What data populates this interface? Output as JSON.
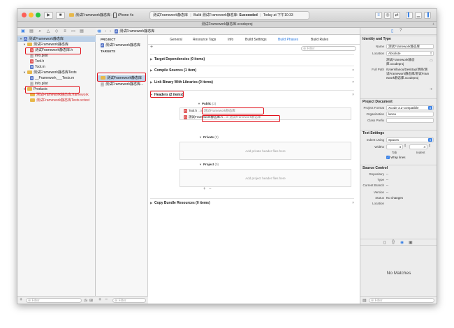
{
  "toolbar": {
    "scheme": "测试Framework静态库",
    "device": "iPhone 4s",
    "activity": {
      "project": "测试Framework静态库",
      "build": "Build 测试Framework静态库: ",
      "status": "Succeeded",
      "time": "Today at 下午10:33"
    }
  },
  "path_title": "测试Framework静态库.xcodeproj",
  "navigator": {
    "items": [
      {
        "label": "测试Framework静态库",
        "kind": "project",
        "indent": 0
      },
      {
        "label": "测试Framework静态库",
        "kind": "folder",
        "indent": 1
      },
      {
        "label": "测试Framework静态库.h",
        "kind": "h",
        "indent": 2
      },
      {
        "label": "Info.plist",
        "kind": "plist",
        "indent": 2
      },
      {
        "label": "Tool.h",
        "kind": "h",
        "indent": 2
      },
      {
        "label": "Tool.m",
        "kind": "m",
        "indent": 2
      },
      {
        "label": "测试Framework静态库Tests",
        "kind": "folder",
        "indent": 1
      },
      {
        "label": "__Framework___Tests.m",
        "kind": "m",
        "indent": 2
      },
      {
        "label": "Info.plist",
        "kind": "plist",
        "indent": 2
      },
      {
        "label": "Products",
        "kind": "folder",
        "indent": 1
      },
      {
        "label": "测试Framework静态库.framework",
        "kind": "product",
        "indent": 2
      },
      {
        "label": "测试Framework静态库Tests.xctest",
        "kind": "product",
        "indent": 2
      }
    ],
    "filter_placeholder": "Filter"
  },
  "jump_bar": {
    "crumb": "测试Framework静态库"
  },
  "targets_panel": {
    "project_header": "PROJECT",
    "project_item": "测试Framework静态库",
    "targets_header": "TARGETS",
    "target_items": [
      "测试Framework静态库",
      "测试Framework静态库..."
    ],
    "filter_placeholder": "Filter"
  },
  "editor": {
    "tabs": [
      "General",
      "Resource Tags",
      "Info",
      "Build Settings",
      "Build Phases",
      "Build Rules"
    ],
    "active_tab": "Build Phases",
    "filter_placeholder": "Filter",
    "phases": {
      "target_deps": "Target Dependencies (0 items)",
      "compile": "Compile Sources (1 item)",
      "link": "Link Binary With Libraries (0 items)",
      "headers": "Headers (2 items)",
      "copy": "Copy Bundle Resources (0 items)"
    },
    "headers": {
      "public_label": "Public",
      "public_count": "(2)",
      "public_files": [
        {
          "name": "Tool.h",
          "path": "...in 测试Framework静态库"
        },
        {
          "name": "测试Framework静态库.h",
          "path": "...in 测试Framework静态库"
        }
      ],
      "private_label": "Private",
      "private_count": "(0)",
      "private_placeholder": "Add private header files here",
      "project_label": "Project",
      "project_count": "(0)",
      "project_placeholder": "Add project header files here"
    }
  },
  "inspector": {
    "identity_title": "Identity and Type",
    "name_label": "Name",
    "name_value": "测试Framework静态库",
    "location_label": "Location",
    "location_value": "Absolute",
    "location_file": "测试Framework静态库.xcodeproj",
    "fullpath_label": "Full Path",
    "fullpath_value": "/Users/lanou/Desktop/项目/测试Framework静态库/测试Framework静态库.xcodeproj",
    "project_doc_title": "Project Document",
    "format_label": "Project Format",
    "format_value": "Xcode 3.2-compatible",
    "org_label": "Organization",
    "org_value": "lanou",
    "class_prefix_label": "Class Prefix",
    "text_settings_title": "Text Settings",
    "indent_using_label": "Indent Using",
    "indent_using_value": "Spaces",
    "widths_label": "Widths",
    "tab_value": "4",
    "indent_value": "4",
    "tab_label": "Tab",
    "indent_label": "Indent",
    "wrap_lines": "Wrap lines",
    "source_control_title": "Source Control",
    "repository_label": "Repository",
    "type_label": "Type",
    "branch_label": "Current Branch",
    "version_label": "Version",
    "status_label": "Status",
    "status_value": "No changes",
    "sc_location_label": "Location",
    "dash": "--",
    "no_matches": "No Matches",
    "filter_placeholder": "Filter"
  },
  "colors": {
    "accent": "#2a7ae2",
    "highlight": "#e0101a",
    "selection": "#bcd1e8"
  }
}
